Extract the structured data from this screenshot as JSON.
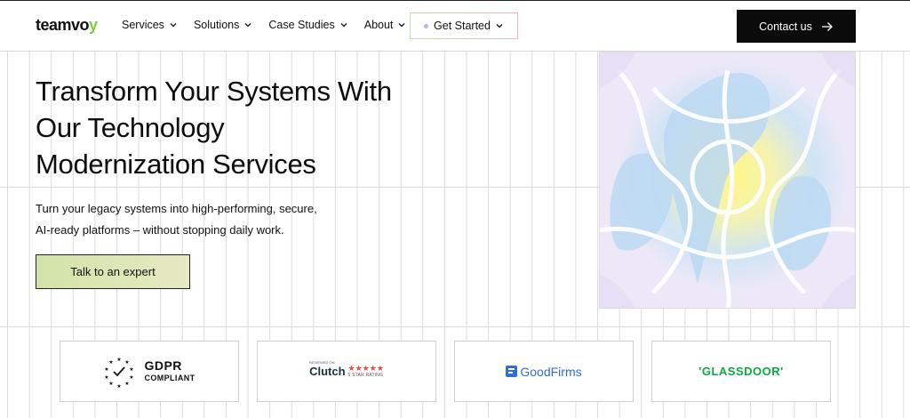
{
  "header": {
    "logo": {
      "prefix": "teamvo",
      "accent": "y"
    },
    "nav": [
      {
        "label": "Services"
      },
      {
        "label": "Solutions"
      },
      {
        "label": "Case Studies"
      },
      {
        "label": "About"
      }
    ],
    "get_started_label": "Get Started",
    "contact_label": "Contact us"
  },
  "hero": {
    "title_lines": [
      "Transform Your Systems With",
      "Our Technology",
      "Modernization Services"
    ],
    "subtitle_lines": [
      "Turn your legacy systems into high-performing, secure,",
      "AI-ready platforms – without stopping daily work."
    ],
    "cta_label": "Talk to an expert"
  },
  "badges": {
    "gdpr": {
      "main": "GDPR",
      "sub": "COMPLIANT"
    },
    "clutch": {
      "reviewed": "REVIEWED ON",
      "name": "Clutch",
      "stars": "★★★★★",
      "rating": "5 STAR RATING"
    },
    "goodfirms": {
      "name": "GoodFirms"
    },
    "glassdoor": {
      "name": "'GLASSDOOR'"
    }
  },
  "colors": {
    "accent_green": "#7ccf3c",
    "button_dark": "#0b0b0b",
    "cta_gradient_start": "#d2e3a8",
    "cta_gradient_end": "#e6e9c2",
    "goodfirms_blue": "#2f6fdd",
    "glassdoor_green": "#0caa41",
    "clutch_red": "#ef4335"
  },
  "icons": {
    "dropdown": "chevron-down-icon",
    "contact_arrow": "arrow-right-icon",
    "gdpr": "eu-stars-check-icon",
    "goodfirms": "goodfirms-logo-icon"
  }
}
